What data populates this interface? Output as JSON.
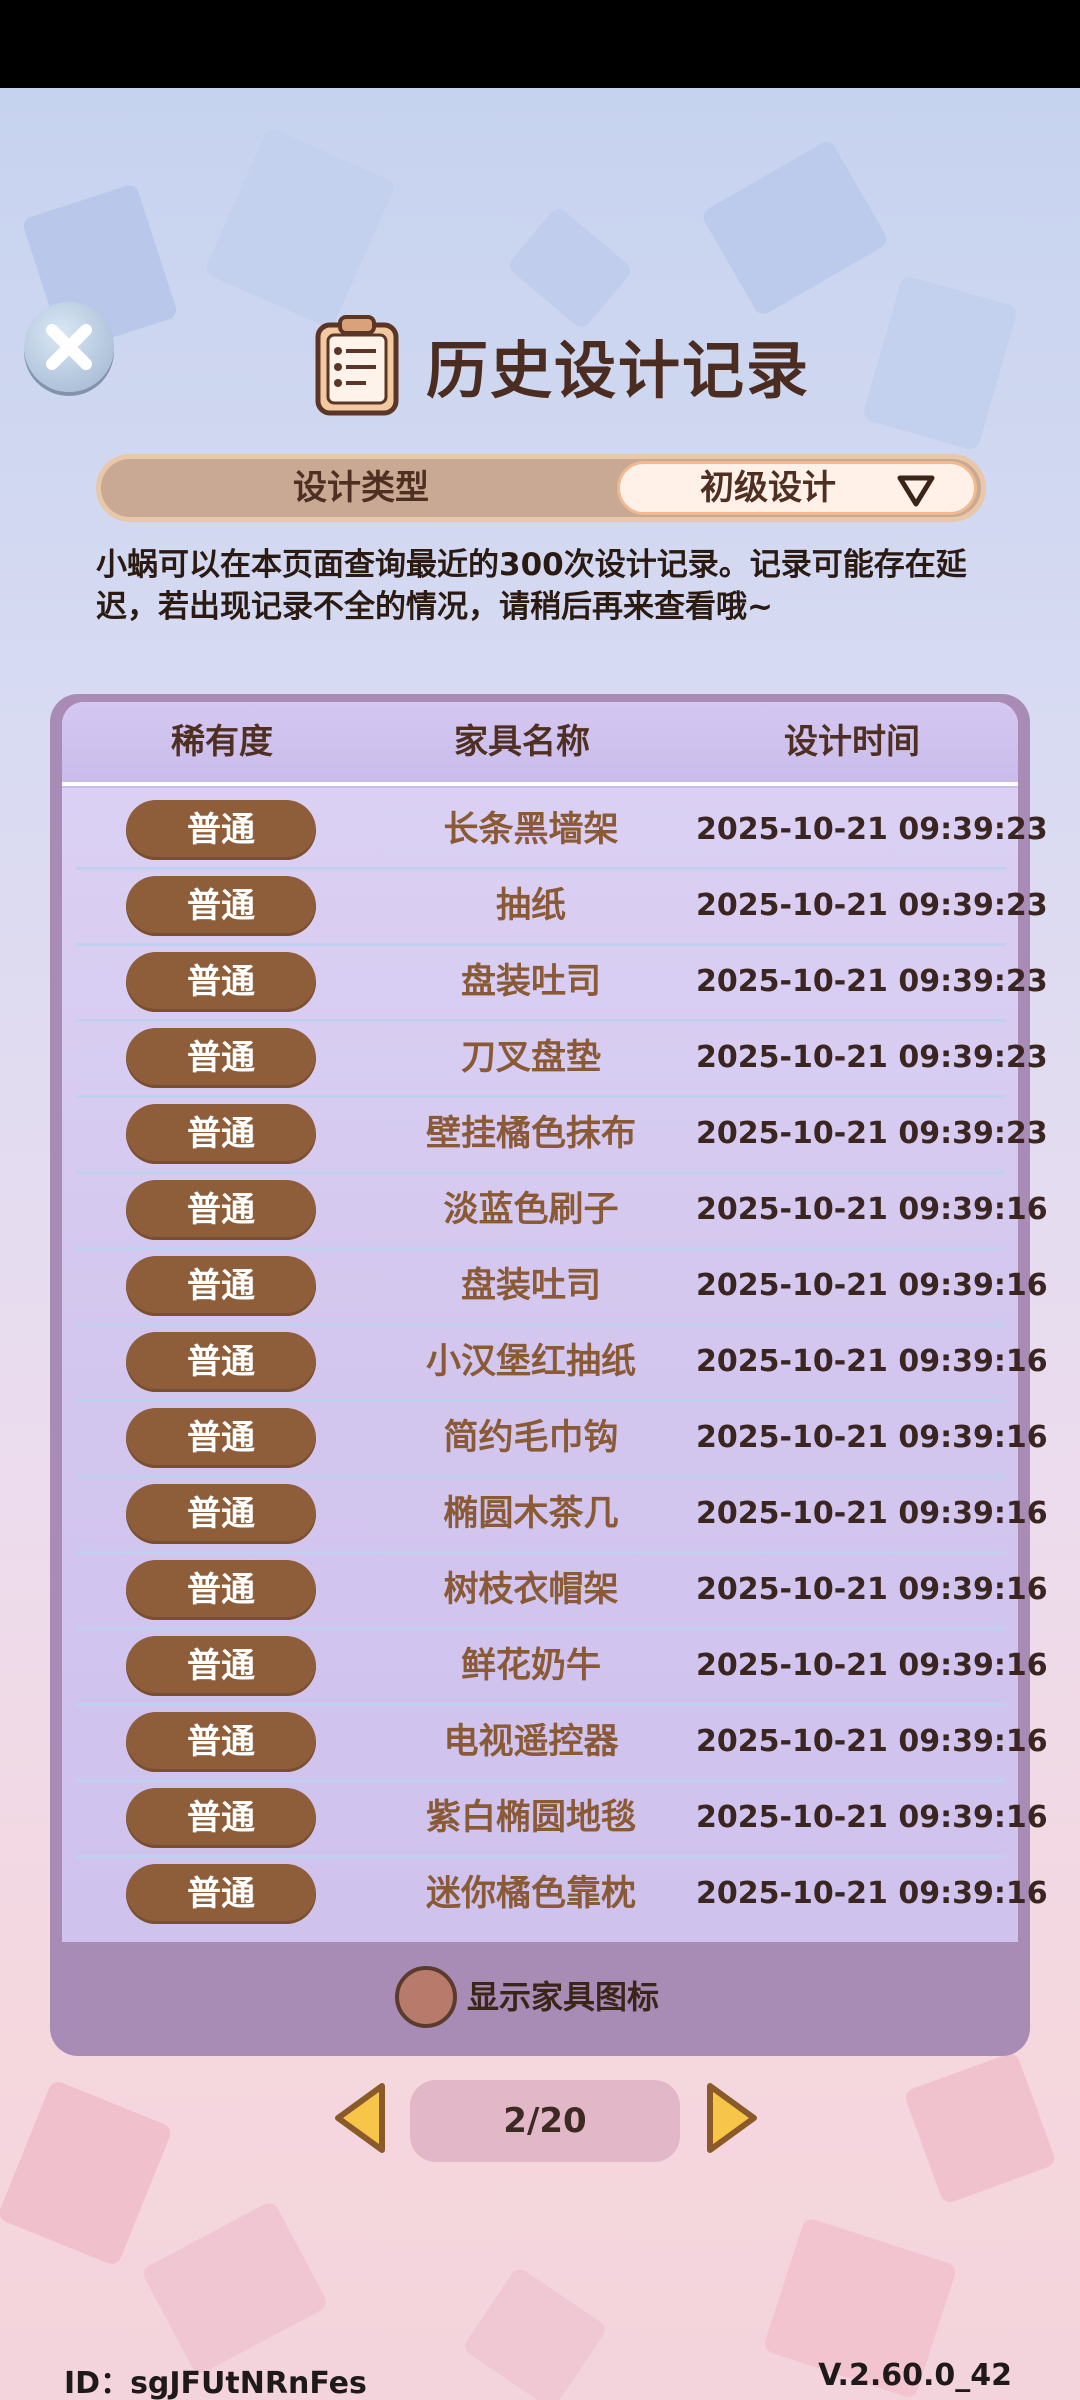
{
  "header": {
    "title": "历史设计记录"
  },
  "filter": {
    "type_label": "设计类型",
    "selected": "初级设计"
  },
  "notice": "小蜗可以在本页面查询最近的300次设计记录。记录可能存在延迟，若出现记录不全的情况，请稍后再来查看哦~",
  "table": {
    "columns": [
      "稀有度",
      "家具名称",
      "设计时间"
    ],
    "rows": [
      {
        "rarity": "普通",
        "name": "长条黑墙架",
        "time": "2025-10-21 09:39:23"
      },
      {
        "rarity": "普通",
        "name": "抽纸",
        "time": "2025-10-21 09:39:23"
      },
      {
        "rarity": "普通",
        "name": "盘装吐司",
        "time": "2025-10-21 09:39:23"
      },
      {
        "rarity": "普通",
        "name": "刀叉盘垫",
        "time": "2025-10-21 09:39:23"
      },
      {
        "rarity": "普通",
        "name": "壁挂橘色抹布",
        "time": "2025-10-21 09:39:23"
      },
      {
        "rarity": "普通",
        "name": "淡蓝色刷子",
        "time": "2025-10-21 09:39:16"
      },
      {
        "rarity": "普通",
        "name": "盘装吐司",
        "time": "2025-10-21 09:39:16"
      },
      {
        "rarity": "普通",
        "name": "小汉堡红抽纸",
        "time": "2025-10-21 09:39:16"
      },
      {
        "rarity": "普通",
        "name": "简约毛巾钩",
        "time": "2025-10-21 09:39:16"
      },
      {
        "rarity": "普通",
        "name": "椭圆木茶几",
        "time": "2025-10-21 09:39:16"
      },
      {
        "rarity": "普通",
        "name": "树枝衣帽架",
        "time": "2025-10-21 09:39:16"
      },
      {
        "rarity": "普通",
        "name": "鲜花奶牛",
        "time": "2025-10-21 09:39:16"
      },
      {
        "rarity": "普通",
        "name": "电视遥控器",
        "time": "2025-10-21 09:39:16"
      },
      {
        "rarity": "普通",
        "name": "紫白椭圆地毯",
        "time": "2025-10-21 09:39:16"
      },
      {
        "rarity": "普通",
        "name": "迷你橘色靠枕",
        "time": "2025-10-21 09:39:16"
      }
    ]
  },
  "show_icons_label": "显示家具图标",
  "pager": {
    "text": "2/20",
    "current": 2,
    "total": 20
  },
  "footer": {
    "id": "ID：sgJFUtNRnFes",
    "version": "V.2.60.0_42"
  },
  "icons": {
    "close": "close-icon",
    "clipboard": "clipboard-icon",
    "dropdown": "triangle-down-icon",
    "prev": "arrow-left-icon",
    "next": "arrow-right-icon"
  },
  "colors": {
    "rarity_common": "#8e5e3a",
    "panel": "#a88cb6",
    "furniture_name": "#8a5a37"
  }
}
